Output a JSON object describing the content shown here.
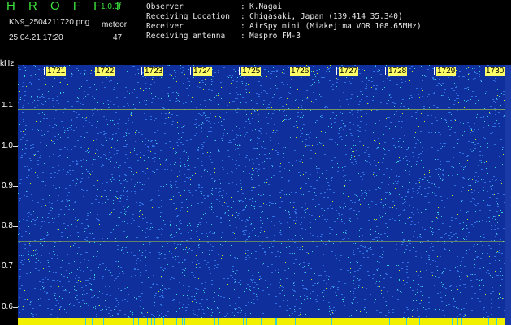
{
  "header": {
    "brand": "H R O F F T",
    "version": "1.0.0f",
    "filename": "KN9_2504211720.png",
    "meteor_label": "meteor",
    "datetime": "25.04.21 17:20",
    "meteor_count": "47"
  },
  "info": [
    {
      "label": "Observer",
      "value": "K.Nagai"
    },
    {
      "label": "Receiving Location",
      "value": "Chigasaki, Japan (139.414 35.340)"
    },
    {
      "label": "Receiver",
      "value": "AirSpy mini (Miakejima VOR 108.65MHz)"
    },
    {
      "label": "Receiving antenna",
      "value": "Maspro FM-3"
    }
  ],
  "axis": {
    "y_unit": "kHz",
    "y_ticks": [
      "1.1",
      "1.0",
      "0.9",
      "0.8",
      "0.7",
      "0.6"
    ],
    "x_ticks": [
      "1721",
      "1722",
      "1723",
      "1724",
      "1725",
      "1726",
      "1727",
      "1728",
      "1729",
      "1730"
    ]
  },
  "colors": {
    "background": "#0f2f9c",
    "noise_low": "#2f6fe0",
    "noise_mid": "#38d0d8",
    "noise_high": "#c8e830",
    "brand": "#3ce03c",
    "baseline": "#f0f000"
  }
}
